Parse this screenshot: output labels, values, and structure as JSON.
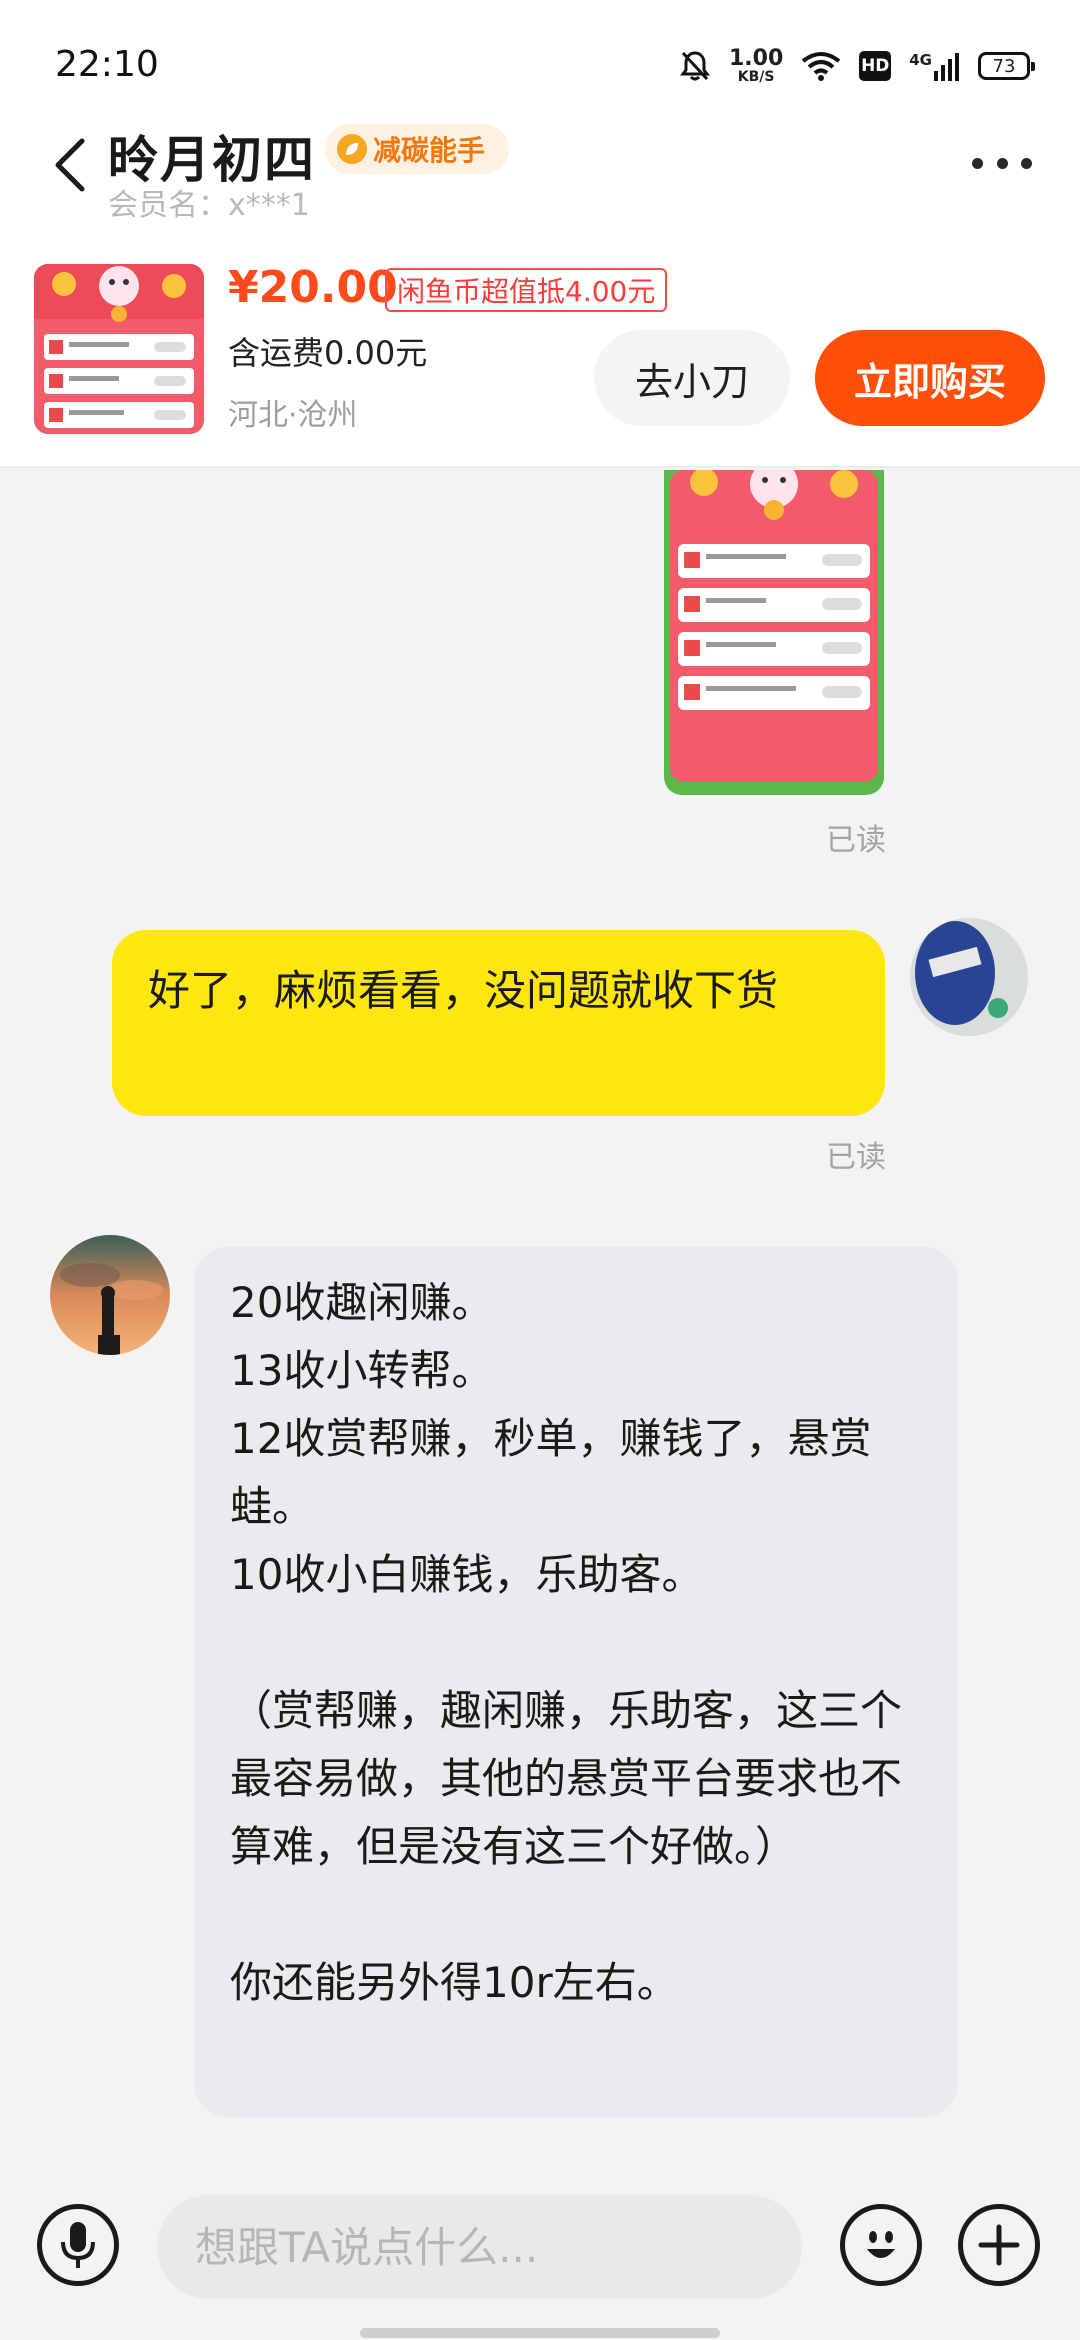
{
  "status_bar": {
    "time": "22:10",
    "net_speed_value": "1.00",
    "net_speed_unit": "KB/S",
    "hd_label": "HD",
    "network_type": "4G",
    "battery_level": "73"
  },
  "header": {
    "name": "昤月初四",
    "badge_label": "减碳能手",
    "member_label": "会员名：",
    "member_id": "x***1"
  },
  "product": {
    "price": "¥20.00",
    "coin_offer": "闲鱼币超值抵4.00元",
    "shipping": "含运费0.00元",
    "location": "河北·沧州",
    "bargain_label": "去小刀",
    "buy_label": "立即购买"
  },
  "messages": {
    "image_read_status": "已读",
    "text_me": "好了，麻烦看看，没问题就收下货",
    "text_me_read_status": "已读",
    "text_other_lines": [
      "20收趣闲赚。",
      "13收小转帮。",
      "12收赏帮赚，秒单，赚钱了，悬赏蛙。",
      "10收小白赚钱，乐助客。",
      "",
      "（赏帮赚，趣闲赚，乐助客，这三个最容易做，其他的悬赏平台要求也不算难，但是没有这三个好做。）",
      "",
      "你还能另外得10r左右。"
    ]
  },
  "input_bar": {
    "placeholder": "想跟TA说点什么..."
  },
  "colors": {
    "accent_orange": "#ff4f0a",
    "price_red": "#ff4a1c",
    "my_bubble": "#ffe60f",
    "other_bubble": "#ebebef"
  }
}
